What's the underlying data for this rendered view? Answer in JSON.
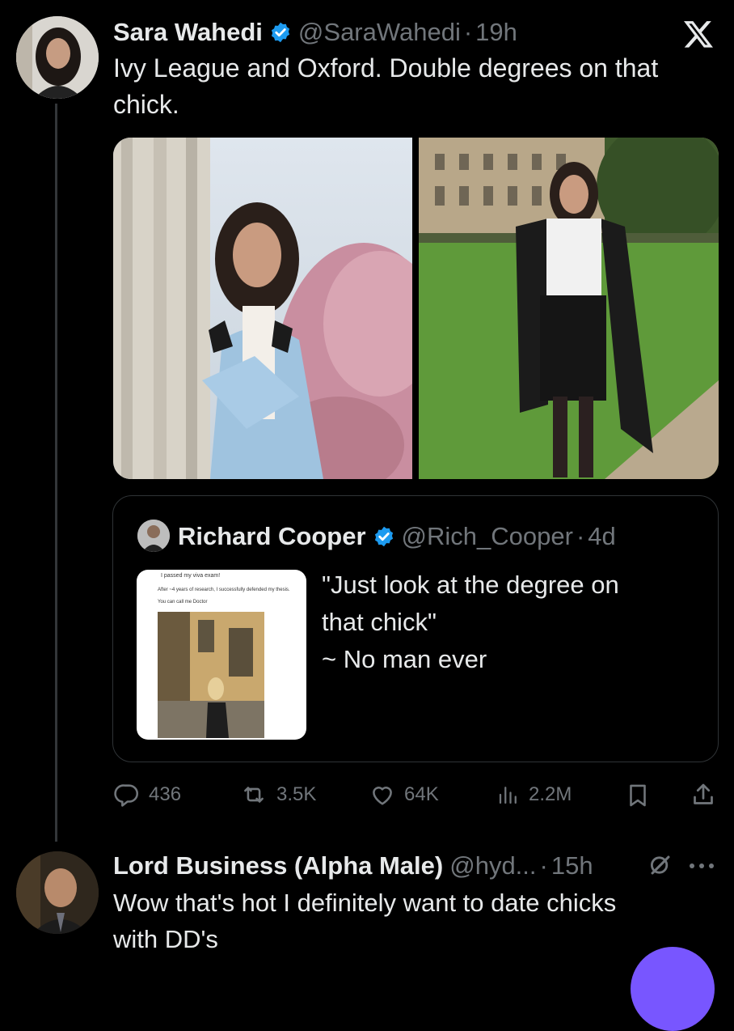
{
  "tweet": {
    "author_name": "Sara Wahedi",
    "handle": "@SaraWahedi",
    "separator": "·",
    "time": "19h",
    "text": "Ivy League and Oxford. Double degrees on that chick.",
    "platform_icon": "x-logo-icon"
  },
  "quote": {
    "author_name": "Richard Cooper",
    "handle": "@Rich_Cooper",
    "separator": "·",
    "time": "4d",
    "text_line1": "\"Just look at the degree on",
    "text_line2": "that chick\"",
    "text_line3": "~ No man ever",
    "thumb": {
      "headline": "I passed my viva exam!",
      "body": "After ~4 years of research, I successfully defended my thesis.",
      "body2": "You can call me Doctor"
    }
  },
  "actions": {
    "replies": "436",
    "reposts": "3.5K",
    "likes": "64K",
    "views": "2.2M"
  },
  "reply": {
    "author_name": "Lord Business (Alpha Male)",
    "handle": "@hyd...",
    "separator": "·",
    "time": "15h",
    "text_line1": "Wow that's hot I definitely want to date chicks",
    "text_line2": "with DD's"
  },
  "colors": {
    "background": "#000000",
    "text": "#e7e9ea",
    "muted": "#71767b",
    "verified": "#1d9bf0",
    "border": "#2f3336",
    "fab": "#7856ff"
  }
}
